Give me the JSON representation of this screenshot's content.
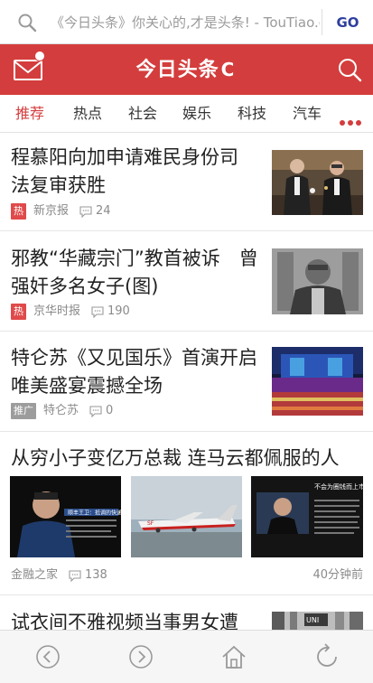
{
  "address_bar": {
    "url_text": "《今日头条》你关心的,才是头条! - TouTiao.com",
    "go_label": "GO",
    "search_icon": "search-icon"
  },
  "header": {
    "logo_text": "今日头条",
    "refresh_glyph": "C",
    "brand_color": "#d43d3d"
  },
  "tabs": [
    {
      "label": "推荐",
      "active": true
    },
    {
      "label": "热点",
      "active": false
    },
    {
      "label": "社会",
      "active": false
    },
    {
      "label": "娱乐",
      "active": false
    },
    {
      "label": "科技",
      "active": false
    },
    {
      "label": "汽车",
      "active": false
    }
  ],
  "articles": [
    {
      "title": "程慕阳向加申请难民身份司法复审获胜",
      "badge": "热",
      "source": "新京报",
      "comments": "24"
    },
    {
      "title": "邪教“华藏宗门”教首被诉　曾强奸多名女子(图)",
      "badge": "热",
      "source": "京华时报",
      "comments": "190"
    },
    {
      "title": "特仑苏《又见国乐》首演开启 唯美盛宴震撼全场",
      "badge": "推广",
      "source": "特仑苏",
      "comments": "0"
    },
    {
      "title": "从穷小子变亿万总裁 连马云都佩服的人",
      "source": "金融之家",
      "comments": "138",
      "time": "40分钟前",
      "image_captions": [
        "顺丰王卫：抵调的快递之王",
        "不会为圈钱而上市"
      ]
    },
    {
      "title": "试衣间不雅视频当事男女遭"
    }
  ],
  "nav": [
    "back-icon",
    "forward-icon",
    "home-icon",
    "refresh-icon"
  ]
}
